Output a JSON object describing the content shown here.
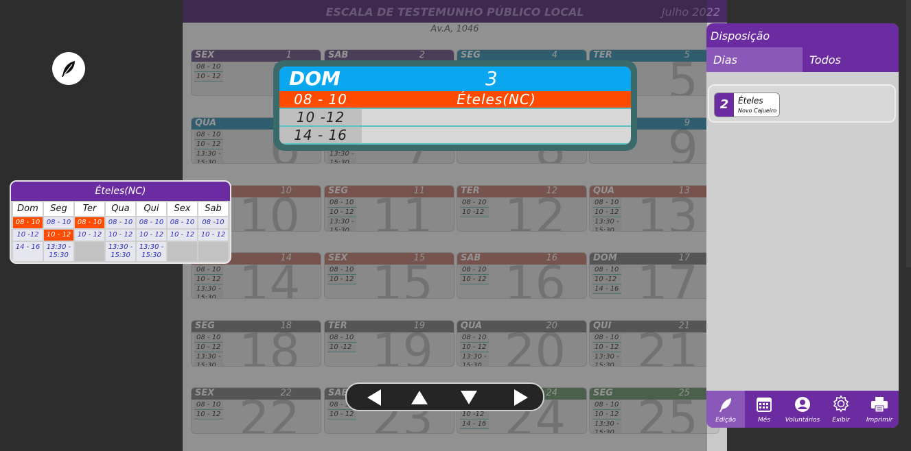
{
  "page": {
    "title": "ESCALA DE TESTEMUNHO PÚBLICO LOCAL",
    "month": "Julho 2022",
    "address": "Av.A, 1046"
  },
  "calendar": [
    {
      "dow": "SEX",
      "day": "1",
      "times": [
        "08 - 10",
        "10 - 12"
      ],
      "color": "purple"
    },
    {
      "dow": "SAB",
      "day": "2",
      "times": [],
      "color": "purple"
    },
    {
      "dow": "SEG",
      "day": "4",
      "times": [],
      "color": "blue"
    },
    {
      "dow": "TER",
      "day": "5",
      "times": [],
      "color": "blue"
    },
    {
      "dow": "QUA",
      "day": "6",
      "times": [
        "08 - 10",
        "10 - 12",
        "13:30 - 15:30"
      ],
      "color": "blue"
    },
    {
      "dow": "",
      "day": "7",
      "times": [
        "08 - 10",
        "10 - 12",
        "13:30 - 15:30"
      ],
      "color": "blue"
    },
    {
      "dow": "SEX",
      "day": "8",
      "times": [
        "08 - 10",
        "10 - 12"
      ],
      "color": "blue"
    },
    {
      "dow": "SAB",
      "day": "9",
      "times": [
        "08 - 10",
        "10 - 12"
      ],
      "color": "blue"
    },
    {
      "dow": "",
      "day": "10",
      "times": [
        "08 - 10",
        "10 - 12"
      ],
      "color": "red"
    },
    {
      "dow": "SEG",
      "day": "11",
      "times": [
        "08 - 10",
        "10 - 12",
        "13:30 - 15:30"
      ],
      "color": "red"
    },
    {
      "dow": "TER",
      "day": "12",
      "times": [
        "08 - 10",
        "10 -12"
      ],
      "color": "red"
    },
    {
      "dow": "QUA",
      "day": "13",
      "times": [
        "08 - 10",
        "10 - 12",
        "13:30 - 15:30"
      ],
      "color": "red"
    },
    {
      "dow": "QUI",
      "day": "14",
      "times": [
        "08 - 10",
        "10 - 12",
        "13:30 - 15:30"
      ],
      "color": "red"
    },
    {
      "dow": "SEX",
      "day": "15",
      "times": [
        "08 - 10",
        "10 - 12"
      ],
      "color": "red"
    },
    {
      "dow": "SAB",
      "day": "16",
      "times": [
        "08 - 10",
        "10 - 12"
      ],
      "color": "red"
    },
    {
      "dow": "DOM",
      "day": "17",
      "times": [
        "08 - 10",
        "10 -12",
        "14 - 16"
      ],
      "color": "gray"
    },
    {
      "dow": "SEG",
      "day": "18",
      "times": [
        "08 - 10",
        "10 - 12",
        "13:30 - 15:30"
      ],
      "color": "gray"
    },
    {
      "dow": "TER",
      "day": "19",
      "times": [
        "08 - 10",
        "10 -12"
      ],
      "color": "gray"
    },
    {
      "dow": "QUA",
      "day": "20",
      "times": [
        "08 - 10",
        "10 - 12",
        "13:30 - 15:30"
      ],
      "color": "gray"
    },
    {
      "dow": "QUI",
      "day": "21",
      "times": [
        "08 - 10",
        "10 - 12",
        "13:30 - 15:30"
      ],
      "color": "gray"
    },
    {
      "dow": "SEX",
      "day": "22",
      "times": [
        "08 - 10",
        "10 - 12"
      ],
      "color": "gray"
    },
    {
      "dow": "SAB",
      "day": "23",
      "times": [
        "08 - 10",
        "10 - 12"
      ],
      "color": "gray"
    },
    {
      "dow": "DOM",
      "day": "24",
      "times": [
        "08 - 10",
        "10 -12",
        "14 - 16"
      ],
      "color": "green"
    },
    {
      "dow": "SEG",
      "day": "25",
      "times": [
        "08 - 10",
        "10 - 12",
        "13:30 - 15:30"
      ],
      "color": "green"
    }
  ],
  "popup": {
    "dow": "DOM",
    "day": "3",
    "rows": [
      {
        "time": "08 - 10",
        "name": "Ételes(NC)",
        "selected": true
      },
      {
        "time": "10 -12",
        "name": "",
        "selected": false
      },
      {
        "time": "14 - 16",
        "name": "",
        "selected": false
      }
    ]
  },
  "volunteer": {
    "name": "Ételes(NC)",
    "days": [
      "Dom",
      "Seg",
      "Ter",
      "Qua",
      "Qui",
      "Sex",
      "Sab"
    ],
    "rows": [
      [
        {
          "t": "08 - 10",
          "s": true
        },
        {
          "t": "08 - 10",
          "s": false
        },
        {
          "t": "08 - 10",
          "s": true
        },
        {
          "t": "08 - 10",
          "s": false
        },
        {
          "t": "08 - 10",
          "s": false
        },
        {
          "t": "08 - 10",
          "s": false
        },
        {
          "t": "08 -10",
          "s": false
        }
      ],
      [
        {
          "t": "10 -12",
          "s": false
        },
        {
          "t": "10 - 12",
          "s": true
        },
        {
          "t": "10 - 12",
          "s": false
        },
        {
          "t": "10 - 12",
          "s": false
        },
        {
          "t": "10 - 12",
          "s": false
        },
        {
          "t": "10 - 12",
          "s": false
        },
        {
          "t": "10 - 12",
          "s": false
        }
      ],
      [
        {
          "t": "14 - 16",
          "s": false
        },
        {
          "t": "13:30 - 15:30",
          "s": false
        },
        {
          "t": "",
          "s": false
        },
        {
          "t": "13:30 - 15:30",
          "s": false
        },
        {
          "t": "13:30 - 15:30",
          "s": false
        },
        {
          "t": "",
          "s": false
        },
        {
          "t": "",
          "s": false
        }
      ]
    ]
  },
  "sidebar": {
    "title": "Disposição",
    "tabs": [
      "Dias",
      "Todos"
    ],
    "card": {
      "count": "2",
      "name": "Ételes",
      "sub": "Novo Cajueiro"
    },
    "toolbar": [
      {
        "label": "Edição",
        "icon": "feather-icon"
      },
      {
        "label": "Mês",
        "icon": "calendar-icon"
      },
      {
        "label": "Voluntários",
        "icon": "person-icon"
      },
      {
        "label": "Exibir",
        "icon": "gear-icon"
      },
      {
        "label": "Imprimir",
        "icon": "printer-icon"
      }
    ]
  },
  "colors": {
    "purple": "#6a2ca0",
    "blue": "#0aa6f0",
    "orange": "#ff4b00"
  }
}
